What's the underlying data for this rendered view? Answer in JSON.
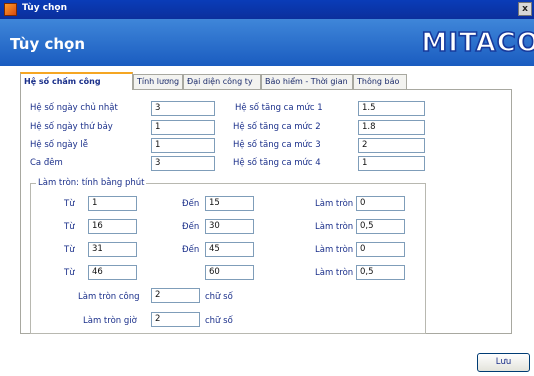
{
  "window": {
    "title": "Tùy chọn",
    "close_glyph": "x"
  },
  "header": {
    "title": "Tùy chọn",
    "logo": "MITACO"
  },
  "tabs": [
    {
      "label": "Hệ số chấm công",
      "active": true
    },
    {
      "label": "Tính lương"
    },
    {
      "label": "Đại diện công ty"
    },
    {
      "label": "Bảo hiểm - Thời gian"
    },
    {
      "label": "Thông báo"
    }
  ],
  "coefficients": {
    "left": [
      {
        "label": "Hệ số ngày chủ nhật",
        "value": "3"
      },
      {
        "label": "Hệ số ngày thứ bảy",
        "value": "1"
      },
      {
        "label": "Hệ số ngày lễ",
        "value": "1"
      },
      {
        "label": "Ca đêm",
        "value": "3"
      }
    ],
    "right": [
      {
        "label": "Hệ số tăng ca mức 1",
        "value": "1.5"
      },
      {
        "label": "Hệ số tăng ca mức 2",
        "value": "1.8"
      },
      {
        "label": "Hệ số tăng ca mức 3",
        "value": "2"
      },
      {
        "label": "Hệ số tăng ca mức 4",
        "value": "1"
      }
    ]
  },
  "rounding": {
    "legend": "Làm tròn: tính bằng phút",
    "from_label": "Từ",
    "to_label": "Đến",
    "round_label": "Làm tròn",
    "rows": [
      {
        "from": "1",
        "to": "15",
        "round": "0"
      },
      {
        "from": "16",
        "to": "30",
        "round": "0,5"
      },
      {
        "from": "31",
        "to": "45",
        "round": "0"
      },
      {
        "from": "46",
        "to": "60",
        "round": "0,5"
      }
    ],
    "work_label": "Làm tròn công",
    "work_value": "2",
    "hour_label": "Làm tròn giờ",
    "hour_value": "2",
    "digits_suffix": "chữ số"
  },
  "actions": {
    "save_label": "Lưu"
  }
}
